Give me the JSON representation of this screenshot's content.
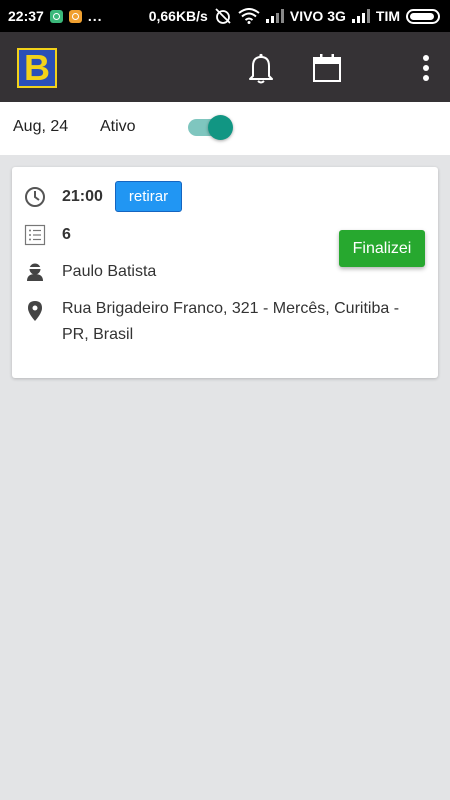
{
  "status_bar": {
    "time": "22:37",
    "dots": "...",
    "speed": "0,66KB/s",
    "carrier1": "VIVO 3G",
    "carrier2": "TIM"
  },
  "app_bar": {
    "logo_letter": "B",
    "icons": [
      "bell-icon",
      "calendar-icon",
      "more-vert-icon"
    ]
  },
  "filter": {
    "date": "Aug, 24",
    "status_label": "Ativo",
    "toggle_on": true
  },
  "order": {
    "time": "21:00",
    "type_button": "retirar",
    "quantity": "6",
    "customer": "Paulo Batista",
    "address": "Rua Brigadeiro Franco, 321 - Mercês, Curitiba - PR, Brasil",
    "finish_button": "Finalizei"
  },
  "colors": {
    "app_bar": "#353235",
    "accent_toggle": "#119683",
    "retirar_button": "#2196f3",
    "finalizei_button": "#27a82f",
    "logo_blue": "#2a4fb8",
    "logo_yellow": "#f2d21a",
    "background": "#e3e4e6"
  }
}
